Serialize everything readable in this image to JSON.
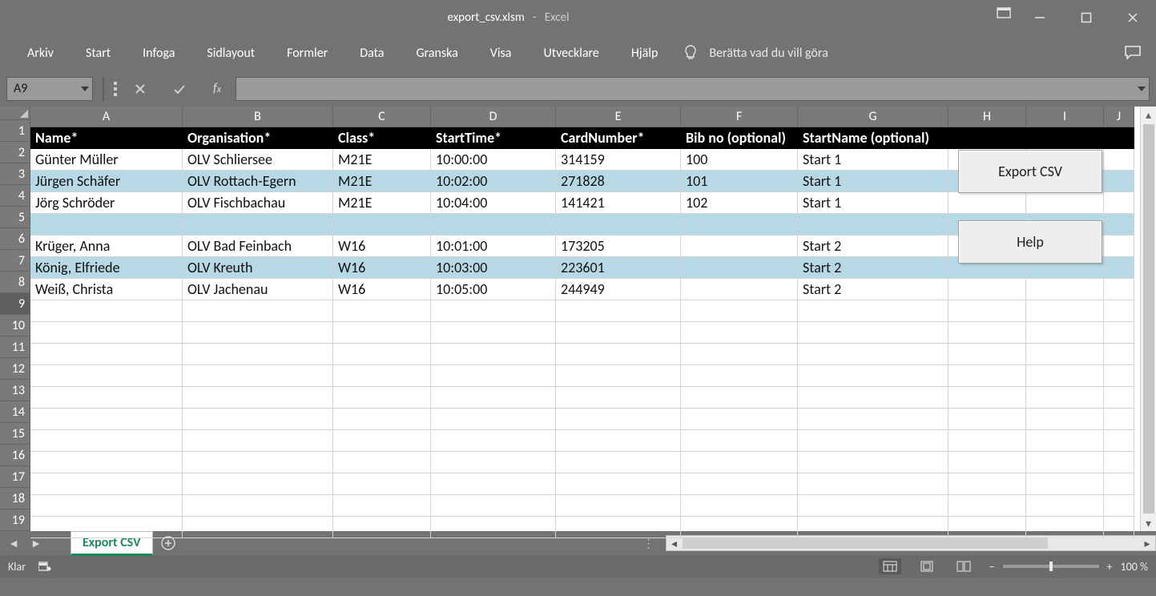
{
  "title": {
    "filename": "export_csv.xlsm",
    "appname": "Excel"
  },
  "ribbon": {
    "tabs": [
      "Arkiv",
      "Start",
      "Infoga",
      "Sidlayout",
      "Formler",
      "Data",
      "Granska",
      "Visa",
      "Utvecklare",
      "Hjälp"
    ],
    "tell_me": "Berätta vad du vill göra"
  },
  "namebox": "A9",
  "columns": [
    "A",
    "B",
    "C",
    "D",
    "E",
    "F",
    "G",
    "H",
    "I",
    "J"
  ],
  "row_numbers": [
    1,
    2,
    3,
    4,
    5,
    6,
    7,
    8,
    9,
    10,
    11,
    12,
    13,
    14,
    15,
    16,
    17,
    18,
    19
  ],
  "header_row": [
    "Name*",
    "Organisation*",
    "Class*",
    "StartTime*",
    "CardNumber*",
    "Bib no (optional)",
    "StartName (optional)"
  ],
  "rows": [
    {
      "band": false,
      "c": [
        "Günter Müller",
        "OLV Schliersee",
        "M21E",
        "10:00:00",
        "314159",
        "100",
        "Start 1"
      ]
    },
    {
      "band": true,
      "c": [
        "Jürgen Schäfer",
        "OLV Rottach-Egern",
        "M21E",
        "10:02:00",
        "271828",
        "101",
        "Start 1"
      ]
    },
    {
      "band": false,
      "c": [
        "Jörg Schröder",
        "OLV Fischbachau",
        "M21E",
        "10:04:00",
        "141421",
        "102",
        "Start 1"
      ]
    },
    {
      "band": true,
      "c": [
        "",
        "",
        "",
        "",
        "",
        "",
        ""
      ]
    },
    {
      "band": false,
      "c": [
        "Krüger, Anna",
        "OLV Bad Feinbach",
        "W16",
        "10:01:00",
        "173205",
        "",
        "Start 2"
      ]
    },
    {
      "band": true,
      "c": [
        "König, Elfriede",
        "OLV Kreuth",
        "W16",
        "10:03:00",
        "223601",
        "",
        "Start 2"
      ]
    },
    {
      "band": false,
      "c": [
        "Weiß, Christa",
        "OLV Jachenau",
        "W16",
        "10:05:00",
        "244949",
        "",
        "Start 2"
      ]
    }
  ],
  "buttons": {
    "export": "Export CSV",
    "help": "Help"
  },
  "sheet_tab": "Export CSV",
  "status": {
    "ready": "Klar",
    "zoom": "100 %"
  }
}
